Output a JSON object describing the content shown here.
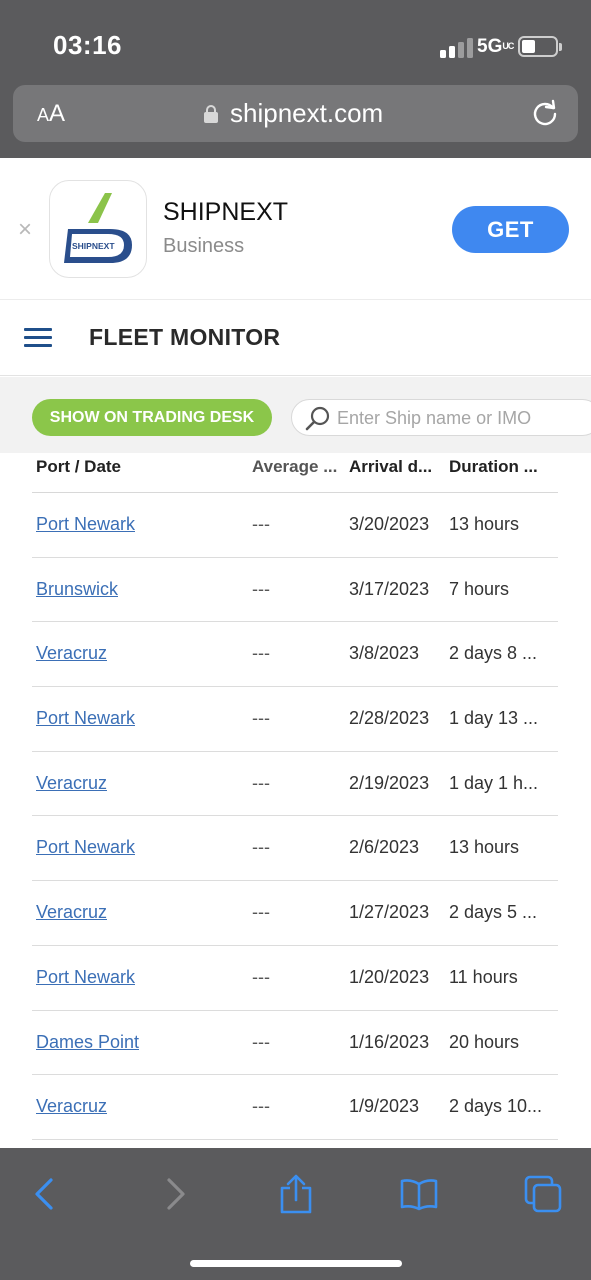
{
  "status_bar": {
    "time": "03:16",
    "network": "5G",
    "network_suffix": "UC",
    "signal_bars_active": 2,
    "signal_bars_total": 4,
    "battery_level": 0.3
  },
  "url_bar": {
    "text_size_label_small": "A",
    "text_size_label_large": "A",
    "url": "shipnext.com",
    "icons": [
      "lock-icon",
      "reload-icon"
    ]
  },
  "app_banner": {
    "close_label": "×",
    "app_name": "SHIPNEXT",
    "category": "Business",
    "get_label": "GET",
    "logo_text": "SHIPNEXT",
    "colors": {
      "logo_green": "#8bc34a",
      "logo_blue": "#2a4e8c",
      "get_button": "#3f88f0"
    }
  },
  "header": {
    "title": "FLEET MONITOR"
  },
  "toolbar": {
    "trading_desk_label": "SHOW ON TRADING DESK",
    "search_placeholder": "Enter Ship name or IMO"
  },
  "table": {
    "columns": [
      "Port / Date",
      "Average ...",
      "Arrival d...",
      "Duration ..."
    ],
    "rows": [
      {
        "port": "Port Newark",
        "average": "---",
        "arrival": "3/20/2023",
        "duration": "13 hours"
      },
      {
        "port": "Brunswick",
        "average": "---",
        "arrival": "3/17/2023",
        "duration": "7 hours"
      },
      {
        "port": "Veracruz",
        "average": "---",
        "arrival": "3/8/2023",
        "duration": "2 days 8 ..."
      },
      {
        "port": "Port Newark",
        "average": "---",
        "arrival": "2/28/2023",
        "duration": "1 day 13 ..."
      },
      {
        "port": "Veracruz",
        "average": "---",
        "arrival": "2/19/2023",
        "duration": "1 day 1 h..."
      },
      {
        "port": "Port Newark",
        "average": "---",
        "arrival": "2/6/2023",
        "duration": "13 hours"
      },
      {
        "port": "Veracruz",
        "average": "---",
        "arrival": "1/27/2023",
        "duration": "2 days 5 ..."
      },
      {
        "port": "Port Newark",
        "average": "---",
        "arrival": "1/20/2023",
        "duration": "11 hours"
      },
      {
        "port": "Dames Point",
        "average": "---",
        "arrival": "1/16/2023",
        "duration": "20 hours"
      },
      {
        "port": "Veracruz",
        "average": "---",
        "arrival": "1/9/2023",
        "duration": "2 days 10..."
      }
    ]
  },
  "browser_toolbar": {
    "icons": [
      "back-icon",
      "forward-icon",
      "share-icon",
      "bookmarks-icon",
      "tabs-icon"
    ],
    "accent_color": "#3b8ff0"
  }
}
